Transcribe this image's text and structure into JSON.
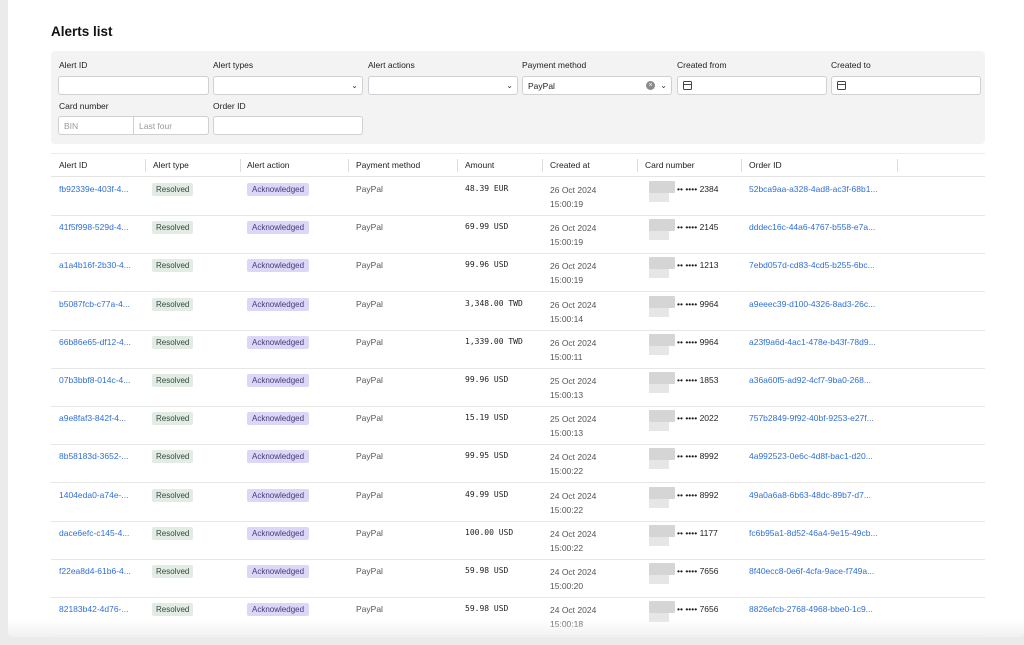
{
  "page_title": "Alerts list",
  "filters": {
    "alert_id_label": "Alert ID",
    "alert_types_label": "Alert types",
    "alert_actions_label": "Alert actions",
    "payment_method_label": "Payment method",
    "payment_method_value": "PayPal",
    "created_from_label": "Created from",
    "created_to_label": "Created to",
    "card_number_label": "Card number",
    "bin_placeholder": "BIN",
    "last_four_placeholder": "Last four",
    "order_id_label": "Order ID"
  },
  "table": {
    "headers": [
      "Alert ID",
      "Alert type",
      "Alert action",
      "Payment method",
      "Amount",
      "Created at",
      "Card number",
      "Order ID"
    ],
    "rows": [
      {
        "alert_id": "fb92339e-403f-4...",
        "type": "Resolved",
        "action": "Acknowledged",
        "payment": "PayPal",
        "amount": "48.39 EUR",
        "date": "26 Oct 2024",
        "time": "15:00:19",
        "card": "•• •••• 2384",
        "order": "52bca9aa-a328-4ad8-ac3f-68b1..."
      },
      {
        "alert_id": "41f5f998-529d-4...",
        "type": "Resolved",
        "action": "Acknowledged",
        "payment": "PayPal",
        "amount": "69.99 USD",
        "date": "26 Oct 2024",
        "time": "15:00:19",
        "card": "•• •••• 2145",
        "order": "dddec16c-44a6-4767-b558-e7a..."
      },
      {
        "alert_id": "a1a4b16f-2b30-4...",
        "type": "Resolved",
        "action": "Acknowledged",
        "payment": "PayPal",
        "amount": "99.96 USD",
        "date": "26 Oct 2024",
        "time": "15:00:19",
        "card": "•• •••• 1213",
        "order": "7ebd057d-cd83-4cd5-b255-6bc..."
      },
      {
        "alert_id": "b5087fcb-c77a-4...",
        "type": "Resolved",
        "action": "Acknowledged",
        "payment": "PayPal",
        "amount": "3,348.00 TWD",
        "date": "26 Oct 2024",
        "time": "15:00:14",
        "card": "•• •••• 9964",
        "order": "a9eeec39-d100-4326-8ad3-26c..."
      },
      {
        "alert_id": "66b86e65-df12-4...",
        "type": "Resolved",
        "action": "Acknowledged",
        "payment": "PayPal",
        "amount": "1,339.00 TWD",
        "date": "26 Oct 2024",
        "time": "15:00:11",
        "card": "•• •••• 9964",
        "order": "a23f9a6d-4ac1-478e-b43f-78d9..."
      },
      {
        "alert_id": "07b3bbf8-014c-4...",
        "type": "Resolved",
        "action": "Acknowledged",
        "payment": "PayPal",
        "amount": "99.96 USD",
        "date": "25 Oct 2024",
        "time": "15:00:13",
        "card": "•• •••• 1853",
        "order": "a36a60f5-ad92-4cf7-9ba0-268..."
      },
      {
        "alert_id": "a9e8faf3-842f-4...",
        "type": "Resolved",
        "action": "Acknowledged",
        "payment": "PayPal",
        "amount": "15.19 USD",
        "date": "25 Oct 2024",
        "time": "15:00:13",
        "card": "•• •••• 2022",
        "order": "757b2849-9f92-40bf-9253-e27f..."
      },
      {
        "alert_id": "8b58183d-3652-...",
        "type": "Resolved",
        "action": "Acknowledged",
        "payment": "PayPal",
        "amount": "99.95 USD",
        "date": "24 Oct 2024",
        "time": "15:00:22",
        "card": "•• •••• 8992",
        "order": "4a992523-0e6c-4d8f-bac1-d20..."
      },
      {
        "alert_id": "1404eda0-a74e-...",
        "type": "Resolved",
        "action": "Acknowledged",
        "payment": "PayPal",
        "amount": "49.99 USD",
        "date": "24 Oct 2024",
        "time": "15:00:22",
        "card": "•• •••• 8992",
        "order": "49a0a6a8-6b63-48dc-89b7-d7..."
      },
      {
        "alert_id": "dace6efc-c145-4...",
        "type": "Resolved",
        "action": "Acknowledged",
        "payment": "PayPal",
        "amount": "100.00 USD",
        "date": "24 Oct 2024",
        "time": "15:00:22",
        "card": "•• •••• 1177",
        "order": "fc6b95a1-8d52-46a4-9e15-49cb..."
      },
      {
        "alert_id": "f22ea8d4-61b6-4...",
        "type": "Resolved",
        "action": "Acknowledged",
        "payment": "PayPal",
        "amount": "59.98 USD",
        "date": "24 Oct 2024",
        "time": "15:00:20",
        "card": "•• •••• 7656",
        "order": "8f40ecc8-0e6f-4cfa-9ace-f749a..."
      },
      {
        "alert_id": "82183b42-4d76-...",
        "type": "Resolved",
        "action": "Acknowledged",
        "payment": "PayPal",
        "amount": "59.98 USD",
        "date": "24 Oct 2024",
        "time": "15:00:18",
        "card": "•• •••• 7656",
        "order": "8826efcb-2768-4968-bbe0-1c9..."
      }
    ]
  }
}
